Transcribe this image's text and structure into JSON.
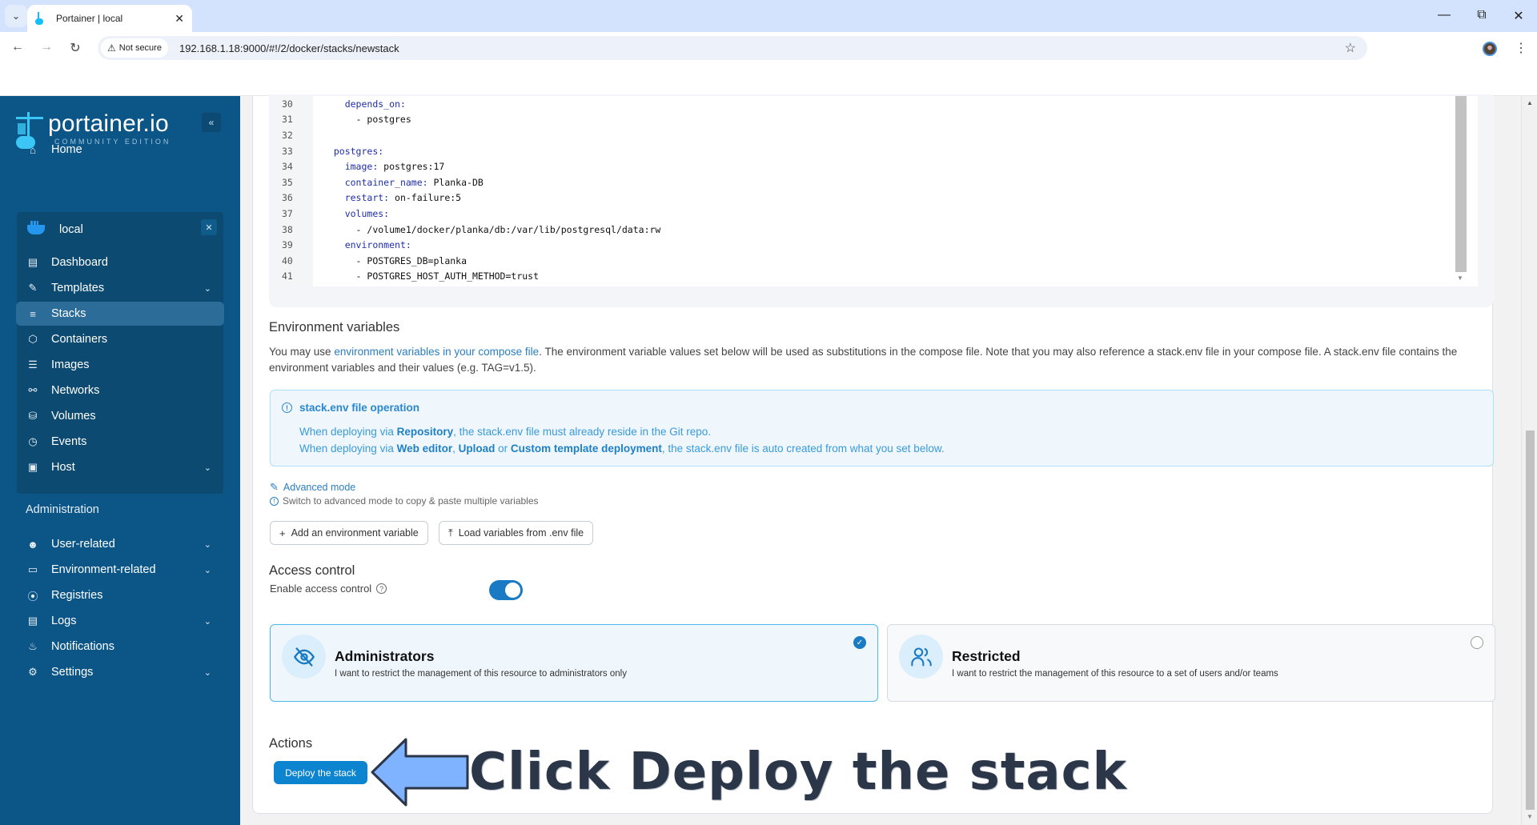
{
  "browser": {
    "tab_title": "Portainer | local",
    "security_label": "Not secure",
    "url": "192.168.1.18:9000/#!/2/docker/stacks/newstack"
  },
  "sidebar": {
    "logo_text": "portainer.io",
    "logo_subtitle": "COMMUNITY EDITION",
    "home_label": "Home",
    "environment": {
      "name": "local",
      "icon": "docker-whale-icon"
    },
    "env_items": [
      {
        "label": "Dashboard",
        "icon": "dashboard-icon",
        "expandable": false
      },
      {
        "label": "Templates",
        "icon": "edit-icon",
        "expandable": true
      },
      {
        "label": "Stacks",
        "icon": "layers-icon",
        "expandable": false,
        "active": true
      },
      {
        "label": "Containers",
        "icon": "box-icon",
        "expandable": false
      },
      {
        "label": "Images",
        "icon": "list-icon",
        "expandable": false
      },
      {
        "label": "Networks",
        "icon": "network-icon",
        "expandable": false
      },
      {
        "label": "Volumes",
        "icon": "database-icon",
        "expandable": false
      },
      {
        "label": "Events",
        "icon": "clock-icon",
        "expandable": false
      },
      {
        "label": "Host",
        "icon": "host-icon",
        "expandable": true
      }
    ],
    "admin_heading": "Administration",
    "admin_items": [
      {
        "label": "User-related",
        "icon": "users-icon",
        "expandable": true
      },
      {
        "label": "Environment-related",
        "icon": "drive-icon",
        "expandable": true
      },
      {
        "label": "Registries",
        "icon": "radio-icon",
        "expandable": false
      },
      {
        "label": "Logs",
        "icon": "file-icon",
        "expandable": true
      },
      {
        "label": "Notifications",
        "icon": "bell-icon",
        "expandable": false
      },
      {
        "label": "Settings",
        "icon": "gear-icon",
        "expandable": true
      }
    ]
  },
  "editor": {
    "lines": [
      {
        "n": "30",
        "indent": "    ",
        "key": "depends_on:",
        "val": ""
      },
      {
        "n": "31",
        "indent": "      ",
        "key": "",
        "val": "- postgres"
      },
      {
        "n": "32",
        "indent": "",
        "key": "",
        "val": ""
      },
      {
        "n": "33",
        "indent": "  ",
        "key": "postgres:",
        "val": ""
      },
      {
        "n": "34",
        "indent": "    ",
        "key": "image:",
        "val": " postgres:17"
      },
      {
        "n": "35",
        "indent": "    ",
        "key": "container_name:",
        "val": " Planka-DB"
      },
      {
        "n": "36",
        "indent": "    ",
        "key": "restart:",
        "val": " on-failure:5"
      },
      {
        "n": "37",
        "indent": "    ",
        "key": "volumes:",
        "val": ""
      },
      {
        "n": "38",
        "indent": "      ",
        "key": "",
        "val": "- /volume1/docker/planka/db:/var/lib/postgresql/data:rw"
      },
      {
        "n": "39",
        "indent": "    ",
        "key": "environment:",
        "val": ""
      },
      {
        "n": "40",
        "indent": "      ",
        "key": "",
        "val": "- POSTGRES_DB=planka"
      },
      {
        "n": "41",
        "indent": "      ",
        "key": "",
        "val": "- POSTGRES_HOST_AUTH_METHOD=trust"
      }
    ]
  },
  "env_vars": {
    "title": "Environment variables",
    "desc_pre": "You may use ",
    "desc_link": "environment variables in your compose file",
    "desc_post": ". The environment variable values set below will be used as substitutions in the compose file. Note that you may also reference a stack.env file in your compose file. A stack.env file contains the environment variables and their values (e.g. TAG=v1.5).",
    "info": {
      "title": "stack.env file operation",
      "line1_pre": "When deploying via ",
      "line1_b1": "Repository",
      "line1_post": ", the stack.env file must already reside in the Git repo.",
      "line2_pre": "When deploying via ",
      "line2_b1": "Web editor",
      "line2_sep1": ", ",
      "line2_b2": "Upload",
      "line2_sep2": " or ",
      "line2_b3": "Custom template deployment",
      "line2_post": ", the stack.env file is auto created from what you set below."
    },
    "advanced_mode_label": "Advanced mode",
    "advanced_mode_hint": "Switch to advanced mode to copy & paste multiple variables",
    "add_button": "Add an environment variable",
    "load_button": "Load variables from .env file"
  },
  "access_control": {
    "title": "Access control",
    "enable_label": "Enable access control",
    "enabled": true,
    "options": [
      {
        "title": "Administrators",
        "desc": "I want to restrict the management of this resource to administrators only",
        "selected": true
      },
      {
        "title": "Restricted",
        "desc": "I want to restrict the management of this resource to a set of users and/or teams",
        "selected": false
      }
    ]
  },
  "actions": {
    "title": "Actions",
    "deploy_button": "Deploy the stack"
  },
  "annotation": {
    "text": "Click Deploy the stack",
    "arrow_color": "#7fb2ff"
  }
}
